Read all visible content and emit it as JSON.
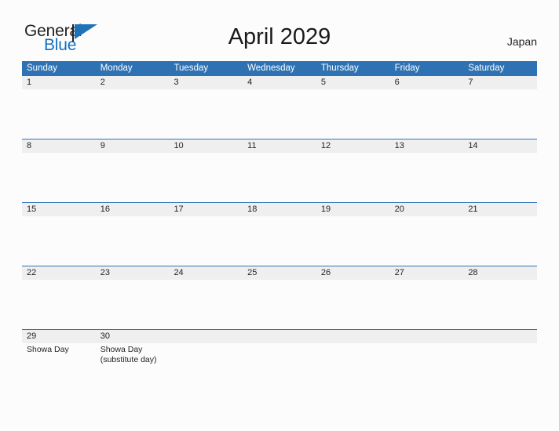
{
  "brand": {
    "line1": "General",
    "line2": "Blue",
    "flag_icon": "brand-flag-icon",
    "text_color": "#231f20",
    "accent_color": "#1270c0"
  },
  "header": {
    "title": "April 2029",
    "locale": "Japan"
  },
  "theme": {
    "header_blue": "#2f72b4",
    "band_gray": "#efefef",
    "page_background": "#fcfcfd",
    "text": "#231f20"
  },
  "calendar": {
    "month": "April",
    "year": "2029",
    "country": "Japan",
    "weekdays": [
      "Sunday",
      "Monday",
      "Tuesday",
      "Wednesday",
      "Thursday",
      "Friday",
      "Saturday"
    ],
    "weeks": [
      {
        "days": [
          {
            "num": "1",
            "events": ""
          },
          {
            "num": "2",
            "events": ""
          },
          {
            "num": "3",
            "events": ""
          },
          {
            "num": "4",
            "events": ""
          },
          {
            "num": "5",
            "events": ""
          },
          {
            "num": "6",
            "events": ""
          },
          {
            "num": "7",
            "events": ""
          }
        ]
      },
      {
        "days": [
          {
            "num": "8",
            "events": ""
          },
          {
            "num": "9",
            "events": ""
          },
          {
            "num": "10",
            "events": ""
          },
          {
            "num": "11",
            "events": ""
          },
          {
            "num": "12",
            "events": ""
          },
          {
            "num": "13",
            "events": ""
          },
          {
            "num": "14",
            "events": ""
          }
        ]
      },
      {
        "days": [
          {
            "num": "15",
            "events": ""
          },
          {
            "num": "16",
            "events": ""
          },
          {
            "num": "17",
            "events": ""
          },
          {
            "num": "18",
            "events": ""
          },
          {
            "num": "19",
            "events": ""
          },
          {
            "num": "20",
            "events": ""
          },
          {
            "num": "21",
            "events": ""
          }
        ]
      },
      {
        "days": [
          {
            "num": "22",
            "events": ""
          },
          {
            "num": "23",
            "events": ""
          },
          {
            "num": "24",
            "events": ""
          },
          {
            "num": "25",
            "events": ""
          },
          {
            "num": "26",
            "events": ""
          },
          {
            "num": "27",
            "events": ""
          },
          {
            "num": "28",
            "events": ""
          }
        ]
      },
      {
        "days": [
          {
            "num": "29",
            "events": "Showa Day"
          },
          {
            "num": "30",
            "events": "Showa Day\n(substitute day)"
          },
          {
            "num": "",
            "events": ""
          },
          {
            "num": "",
            "events": ""
          },
          {
            "num": "",
            "events": ""
          },
          {
            "num": "",
            "events": ""
          },
          {
            "num": "",
            "events": ""
          }
        ]
      }
    ]
  }
}
